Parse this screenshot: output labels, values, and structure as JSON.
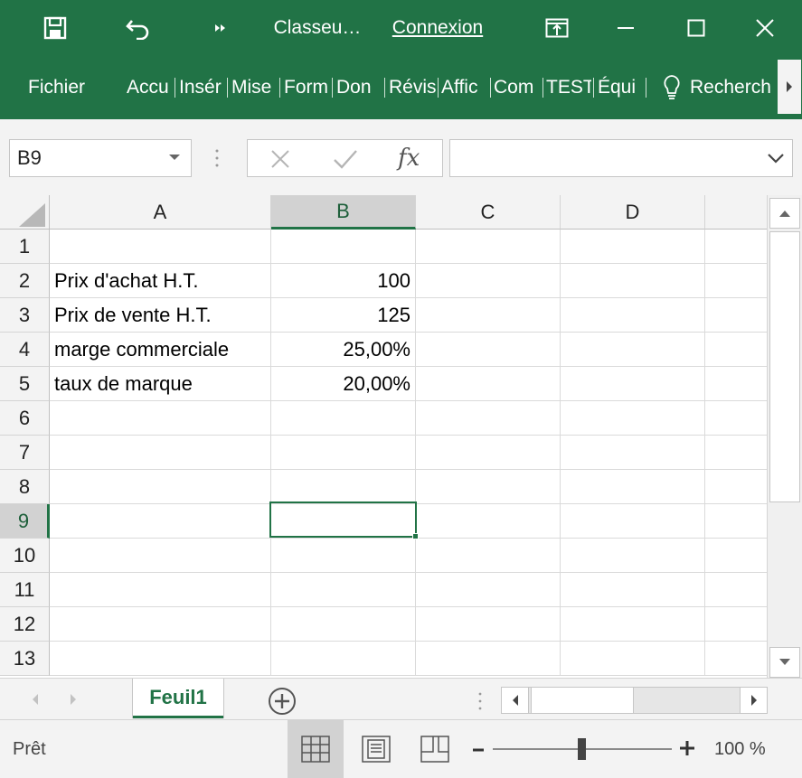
{
  "titlebar": {
    "title": "Classeu…",
    "login_label": "Connexion",
    "icons": [
      "save-icon",
      "undo-icon",
      "more-commands-icon",
      "ribbon-display-icon",
      "minimize-icon",
      "maximize-icon",
      "close-icon"
    ]
  },
  "ribbon": {
    "tabs": [
      "Fichier",
      "Accu",
      "Insér",
      "Mise",
      "Form",
      "Don",
      "Révis",
      "Affic",
      "Com",
      "TEST",
      "Équi"
    ],
    "search_label": "Recherch"
  },
  "formula_bar": {
    "name_box": "B9",
    "formula": ""
  },
  "sheet": {
    "columns": [
      "A",
      "B",
      "C",
      "D"
    ],
    "selected_column": "B",
    "selected_row": "9",
    "rows": [
      {
        "num": "1",
        "a": "",
        "b": ""
      },
      {
        "num": "2",
        "a": "Prix d'achat H.T.",
        "b": "100"
      },
      {
        "num": "3",
        "a": "Prix de vente H.T.",
        "b": "125"
      },
      {
        "num": "4",
        "a": "marge commerciale",
        "b": "25,00%"
      },
      {
        "num": "5",
        "a": "taux de marque",
        "b": "20,00%"
      },
      {
        "num": "6",
        "a": "",
        "b": ""
      },
      {
        "num": "7",
        "a": "",
        "b": ""
      },
      {
        "num": "8",
        "a": "",
        "b": ""
      },
      {
        "num": "9",
        "a": "",
        "b": ""
      },
      {
        "num": "10",
        "a": "",
        "b": ""
      },
      {
        "num": "11",
        "a": "",
        "b": ""
      },
      {
        "num": "12",
        "a": "",
        "b": ""
      },
      {
        "num": "13",
        "a": "",
        "b": ""
      }
    ]
  },
  "tabs": {
    "active_sheet": "Feuil1"
  },
  "statusbar": {
    "status": "Prêt",
    "zoom": "100 %",
    "zoom_level": 1.0
  },
  "colors": {
    "accent": "#217346",
    "header_bg": "#f3f3f3",
    "selected_header_bg": "#d2d2d2"
  }
}
